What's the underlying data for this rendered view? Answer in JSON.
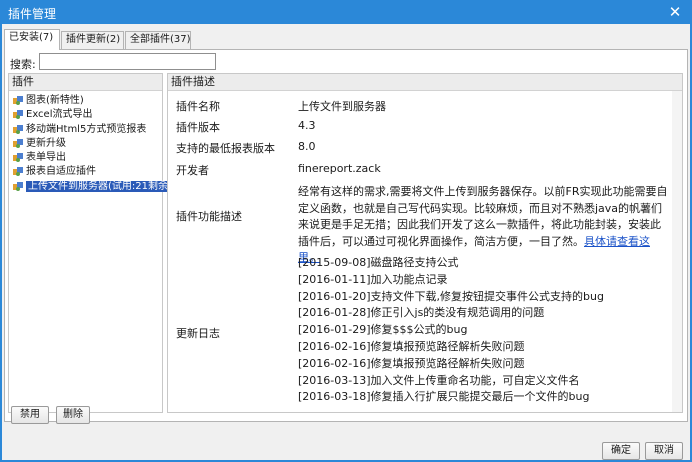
{
  "window": {
    "title": "插件管理"
  },
  "tabs": [
    {
      "label": "已安装(7)"
    },
    {
      "label": "插件更新(2)"
    },
    {
      "label": "全部插件(37)"
    }
  ],
  "search": {
    "label": "搜索:",
    "value": ""
  },
  "left_pane": {
    "header": "插件",
    "items": [
      {
        "label": "图表(新特性)"
      },
      {
        "label": "Excel流式导出"
      },
      {
        "label": "移动端Html5方式预览报表"
      },
      {
        "label": "更新升级"
      },
      {
        "label": "表单导出"
      },
      {
        "label": "报表自适应插件"
      },
      {
        "label": "上传文件到服务器(试用:21剩余)"
      }
    ]
  },
  "right_pane": {
    "header": "插件描述",
    "name_label": "插件名称",
    "name_value": "上传文件到服务器",
    "version_label": "插件版本",
    "version_value": "4.3",
    "minver_label": "支持的最低报表版本",
    "minver_value": "8.0",
    "dev_label": "开发者",
    "dev_value": "finereport.zack",
    "func_label": "插件功能描述",
    "func_text": "经常有这样的需求,需要将文件上传到服务器保存。以前FR实现此功能需要自定义函数，也就是自己写代码实现。比较麻烦，而且对不熟悉java的帆薯们来说更是手足无措；因此我们开发了这么一款插件，将此功能封装，安装此插件后，可以通过可视化界面操作，简洁方便，一目了然。",
    "func_link": "具体请查看这里。",
    "log_label": "更新日志",
    "log_entries": [
      "[2015-09-08]磁盘路径支持公式",
      "[2016-01-11]加入功能点记录",
      "[2016-01-20]支持文件下载,修复按钮提交事件公式支持的bug",
      "[2016-01-28]修正引入js的类没有规范调用的问题",
      "[2016-01-29]修复$$$公式的bug",
      "[2016-02-16]修复填报预览路径解析失败问题",
      "[2016-02-16]修复填报预览路径解析失败问题",
      "[2016-03-13]加入文件上传重命名功能，可自定义文件名",
      "[2016-03-18]修复插入行扩展只能提交最后一个文件的bug"
    ]
  },
  "buttons": {
    "disable": "禁用",
    "delete": "删除",
    "ok": "确定",
    "cancel": "取消"
  },
  "colors": {
    "titlebar": "#2b88d8",
    "selection": "#2a5ab8",
    "link": "#1a52c8"
  }
}
